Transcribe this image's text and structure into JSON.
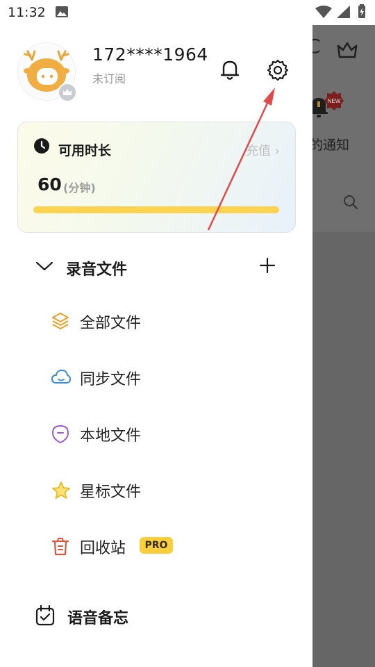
{
  "status_bar": {
    "time": "11:32"
  },
  "profile": {
    "phone": "172****1964",
    "subscription": "未订阅"
  },
  "duration_card": {
    "label": "可用时长",
    "recharge": "充值",
    "minutes": "60",
    "unit": "(分钟)",
    "progress_fraction": 1.0
  },
  "recordings": {
    "title": "录音文件",
    "items": [
      {
        "label": "全部文件",
        "icon": "layers-icon"
      },
      {
        "label": "同步文件",
        "icon": "cloud-icon"
      },
      {
        "label": "本地文件",
        "icon": "local-pin-icon"
      },
      {
        "label": "星标文件",
        "icon": "star-icon"
      },
      {
        "label": "回收站",
        "icon": "trash-icon",
        "badge": "PRO"
      }
    ]
  },
  "memo": {
    "label": "语音备忘"
  },
  "background_app": {
    "notification_text": "的通知",
    "new_badge": "NEW"
  },
  "colors": {
    "accent_yellow": "#fcd350",
    "arrow_red": "#e04a4a"
  }
}
